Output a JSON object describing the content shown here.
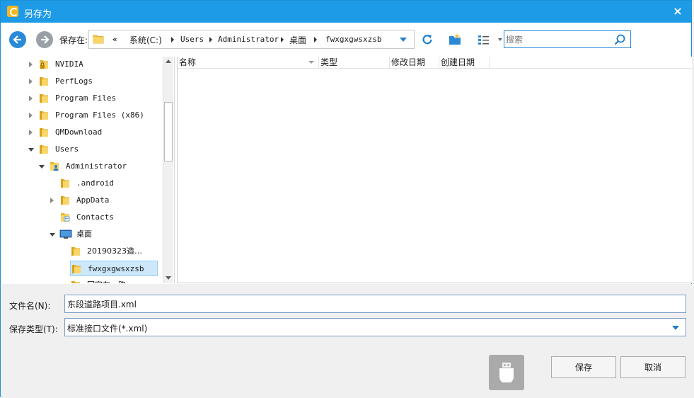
{
  "window": {
    "title": "另存为",
    "close_glyph": "×"
  },
  "toolbar": {
    "save_in_label": "保存在:",
    "breadcrumb": [
      "«",
      "系统(C:)",
      "Users",
      "Administrator",
      "桌面",
      "fwxgxgwsxzsb"
    ],
    "search_placeholder": "搜索"
  },
  "tree": {
    "items": [
      {
        "label": "NVIDIA",
        "icon": "locked-folder-icon",
        "expander": "collapsed",
        "level": 0
      },
      {
        "label": "PerfLogs",
        "icon": "folder-icon",
        "expander": "collapsed",
        "level": 0
      },
      {
        "label": "Program Files",
        "icon": "folder-icon",
        "expander": "collapsed",
        "level": 0
      },
      {
        "label": "Program Files (x86)",
        "icon": "folder-icon",
        "expander": "collapsed",
        "level": 0
      },
      {
        "label": "QMDownload",
        "icon": "folder-icon",
        "expander": "collapsed",
        "level": 0
      },
      {
        "label": "Users",
        "icon": "folder-icon",
        "expander": "expanded",
        "level": 0
      },
      {
        "label": "Administrator",
        "icon": "user-folder-icon",
        "expander": "expanded",
        "level": 1
      },
      {
        "label": ".android",
        "icon": "folder-icon",
        "expander": "none",
        "level": 2
      },
      {
        "label": "AppData",
        "icon": "folder-icon",
        "expander": "collapsed",
        "level": 2
      },
      {
        "label": "Contacts",
        "icon": "contacts-folder-icon",
        "expander": "none",
        "level": 2
      },
      {
        "label": "桌面",
        "icon": "desktop-icon",
        "expander": "expanded",
        "level": 2
      },
      {
        "label": "20190323造…",
        "icon": "folder-icon",
        "expander": "none",
        "level": 3
      },
      {
        "label": "fwxgxgwsxzsb",
        "icon": "folder-icon",
        "expander": "none",
        "level": 3,
        "selected": true
      },
      {
        "label": "回家在一路",
        "icon": "folder-icon",
        "expander": "none",
        "level": 3
      }
    ]
  },
  "filelist": {
    "columns": [
      "名称",
      "类型",
      "修改日期",
      "创建日期"
    ]
  },
  "form": {
    "filename_label": "文件名(N):",
    "filename_value": "东段道路项目.xml",
    "filetype_label": "保存类型(T):",
    "filetype_value": "标准接口文件(*.xml)"
  },
  "buttons": {
    "save": "保存",
    "cancel": "取消"
  },
  "colors": {
    "titlebar": "#1e9be6",
    "accent": "#2a8ad8",
    "folder": "#f4c542",
    "selection": "#cde8fb"
  }
}
